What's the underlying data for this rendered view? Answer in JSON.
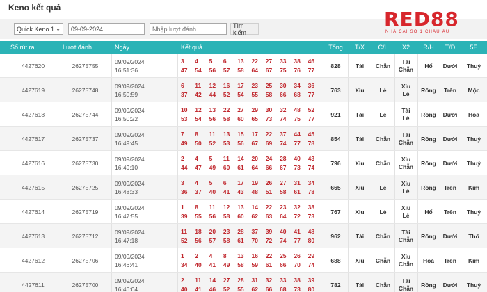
{
  "page_title": "Keno kết quả",
  "controls": {
    "game_select": "Quick Keno 1",
    "date_value": "09-09-2024",
    "draw_placeholder": "Nhập lượt đánh...",
    "search_button": "Tìm kiếm"
  },
  "logo": {
    "brand": "RED88",
    "tagline": "NHÀ CÁI SỐ 1 CHÂU ÂU"
  },
  "columns": [
    "Số rút ra",
    "Lượt đánh",
    "Ngày",
    "Kết quả",
    "Tổng",
    "T/X",
    "C/L",
    "X2",
    "R/H",
    "T/D",
    "5E"
  ],
  "rows": [
    {
      "id": "4427620",
      "draw": "26275755",
      "date": "09/09/2024",
      "time": "16:51:36",
      "top": [
        "3",
        "4",
        "5",
        "6",
        "13",
        "22",
        "27",
        "33",
        "38",
        "46"
      ],
      "bot": [
        "47",
        "54",
        "56",
        "57",
        "58",
        "64",
        "67",
        "75",
        "76",
        "77"
      ],
      "sum": "828",
      "tx": "Tài",
      "cl": "Chẵn",
      "x2": [
        "Tài",
        "Chẵn"
      ],
      "rh": "Hổ",
      "td": "Dưới",
      "e": "Thuỷ"
    },
    {
      "id": "4427619",
      "draw": "26275748",
      "date": "09/09/2024",
      "time": "16:50:59",
      "top": [
        "6",
        "11",
        "12",
        "16",
        "17",
        "23",
        "25",
        "30",
        "34",
        "36"
      ],
      "bot": [
        "37",
        "42",
        "44",
        "52",
        "54",
        "55",
        "58",
        "66",
        "68",
        "77"
      ],
      "sum": "763",
      "tx": "Xỉu",
      "cl": "Lẻ",
      "x2": [
        "Xỉu",
        "Lẻ"
      ],
      "rh": "Rồng",
      "td": "Trên",
      "e": "Mộc"
    },
    {
      "id": "4427618",
      "draw": "26275744",
      "date": "09/09/2024",
      "time": "16:50:22",
      "top": [
        "10",
        "12",
        "13",
        "22",
        "27",
        "29",
        "30",
        "32",
        "48",
        "52"
      ],
      "bot": [
        "53",
        "54",
        "56",
        "58",
        "60",
        "65",
        "73",
        "74",
        "75",
        "77"
      ],
      "sum": "921",
      "tx": "Tài",
      "cl": "Lẻ",
      "x2": [
        "Tài",
        "Lẻ"
      ],
      "rh": "Rồng",
      "td": "Dưới",
      "e": "Hoả"
    },
    {
      "id": "4427617",
      "draw": "26275737",
      "date": "09/09/2024",
      "time": "16:49:45",
      "top": [
        "7",
        "8",
        "11",
        "13",
        "15",
        "17",
        "22",
        "37",
        "44",
        "45"
      ],
      "bot": [
        "49",
        "50",
        "52",
        "53",
        "56",
        "67",
        "69",
        "74",
        "77",
        "78"
      ],
      "sum": "854",
      "tx": "Tài",
      "cl": "Chẵn",
      "x2": [
        "Tài",
        "Chẵn"
      ],
      "rh": "Rồng",
      "td": "Dưới",
      "e": "Thuỷ"
    },
    {
      "id": "4427616",
      "draw": "26275730",
      "date": "09/09/2024",
      "time": "16:49:10",
      "top": [
        "2",
        "4",
        "4",
        "5",
        "11",
        "14",
        "20",
        "24",
        "28",
        "40",
        "43"
      ],
      "bot": [
        "44",
        "47",
        "49",
        "60",
        "61",
        "64",
        "66",
        "67",
        "73",
        "74"
      ],
      "sum": "796",
      "tx": "Xỉu",
      "cl": "Chẵn",
      "x2": [
        "Xỉu",
        "Chẵn"
      ],
      "rh": "Rồng",
      "td": "Dưới",
      "e": "Thuỷ"
    },
    {
      "id": "4427615",
      "draw": "26275725",
      "date": "09/09/2024",
      "time": "16:48:33",
      "top": [
        "3",
        "4",
        "5",
        "6",
        "17",
        "19",
        "26",
        "27",
        "31",
        "34"
      ],
      "bot": [
        "36",
        "37",
        "40",
        "41",
        "43",
        "48",
        "51",
        "58",
        "61",
        "78"
      ],
      "sum": "665",
      "tx": "Xỉu",
      "cl": "Lẻ",
      "x2": [
        "Xỉu",
        "Lẻ"
      ],
      "rh": "Rồng",
      "td": "Trên",
      "e": "Kim"
    },
    {
      "id": "4427614",
      "draw": "26275719",
      "date": "09/09/2024",
      "time": "16:47:55",
      "top": [
        "1",
        "8",
        "11",
        "12",
        "13",
        "14",
        "22",
        "23",
        "32",
        "38"
      ],
      "bot": [
        "39",
        "55",
        "56",
        "58",
        "60",
        "62",
        "63",
        "64",
        "72",
        "73"
      ],
      "sum": "767",
      "tx": "Xỉu",
      "cl": "Lẻ",
      "x2": [
        "Xỉu",
        "Lẻ"
      ],
      "rh": "Hổ",
      "td": "Trên",
      "e": "Thuỷ"
    },
    {
      "id": "4427613",
      "draw": "26275712",
      "date": "09/09/2024",
      "time": "16:47:18",
      "top": [
        "11",
        "18",
        "20",
        "23",
        "28",
        "37",
        "39",
        "40",
        "41",
        "48"
      ],
      "bot": [
        "52",
        "56",
        "57",
        "58",
        "61",
        "70",
        "72",
        "74",
        "77",
        "80"
      ],
      "sum": "962",
      "tx": "Tài",
      "cl": "Chẵn",
      "x2": [
        "Tài",
        "Chẵn"
      ],
      "rh": "Rồng",
      "td": "Dưới",
      "e": "Thổ"
    },
    {
      "id": "4427612",
      "draw": "26275706",
      "date": "09/09/2024",
      "time": "16:46:41",
      "top": [
        "1",
        "2",
        "4",
        "8",
        "13",
        "16",
        "22",
        "25",
        "26",
        "29"
      ],
      "bot": [
        "34",
        "40",
        "41",
        "49",
        "58",
        "59",
        "61",
        "66",
        "70",
        "74"
      ],
      "sum": "688",
      "tx": "Xỉu",
      "cl": "Chẵn",
      "x2": [
        "Xỉu",
        "Chẵn"
      ],
      "rh": "Hoà",
      "td": "Trên",
      "e": "Kim"
    },
    {
      "id": "4427611",
      "draw": "26275700",
      "date": "09/09/2024",
      "time": "16:46:04",
      "top": [
        "2",
        "11",
        "14",
        "27",
        "28",
        "31",
        "32",
        "33",
        "38",
        "39"
      ],
      "bot": [
        "40",
        "41",
        "46",
        "52",
        "55",
        "62",
        "66",
        "68",
        "73",
        "80"
      ],
      "sum": "782",
      "tx": "Tài",
      "cl": "Chẵn",
      "x2": [
        "Tài",
        "Chẵn"
      ],
      "rh": "Rồng",
      "td": "Dưới",
      "e": "Thuỷ"
    }
  ]
}
